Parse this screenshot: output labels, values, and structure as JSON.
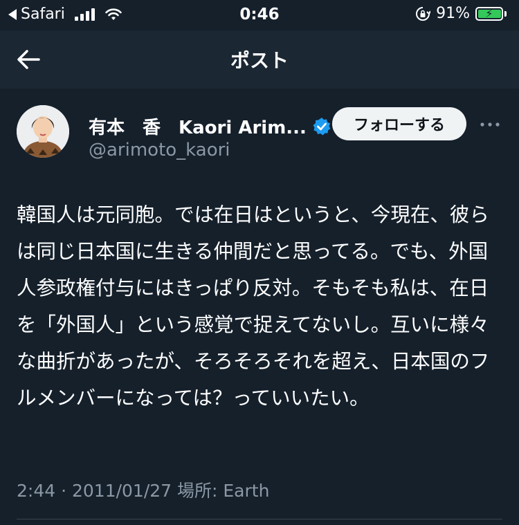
{
  "status_bar": {
    "back_app": "Safari",
    "time": "0:46",
    "battery_percent": "91%",
    "battery_level": 0.91,
    "icons": [
      "back-triangle-icon",
      "signal-icon",
      "wifi-icon",
      "lock-rotation-icon",
      "battery-charging-icon"
    ]
  },
  "nav": {
    "title": "ポスト",
    "back_icon": "back-arrow-icon"
  },
  "author": {
    "name": "有本　香　Kaori Arim...",
    "handle": "@arimoto_kaori",
    "verified": true,
    "verified_color": "#1d9bf0",
    "follow_label": "フォローする",
    "more_icon": "more-horizontal-icon"
  },
  "tweet": {
    "text": "韓国人は元同胞。では在日はというと、今現在、彼らは同じ日本国に生きる仲間だと思ってる。でも、外国人参政権付与にはきっぱり反対。そもそも私は、在日を「外国人」という感覚で捉えてないし。互いに様々な曲折があったが、そろそろそれを超え、日本国のフルメンバーになっては？っていいたい。",
    "meta": "2:44 · 2011/01/27 場所: Earth"
  },
  "colors": {
    "background": "#15202b",
    "nav_background": "#1b2733",
    "secondary_text": "#8b98a5",
    "accent": "#1d9bf0",
    "battery": "#34c759"
  }
}
